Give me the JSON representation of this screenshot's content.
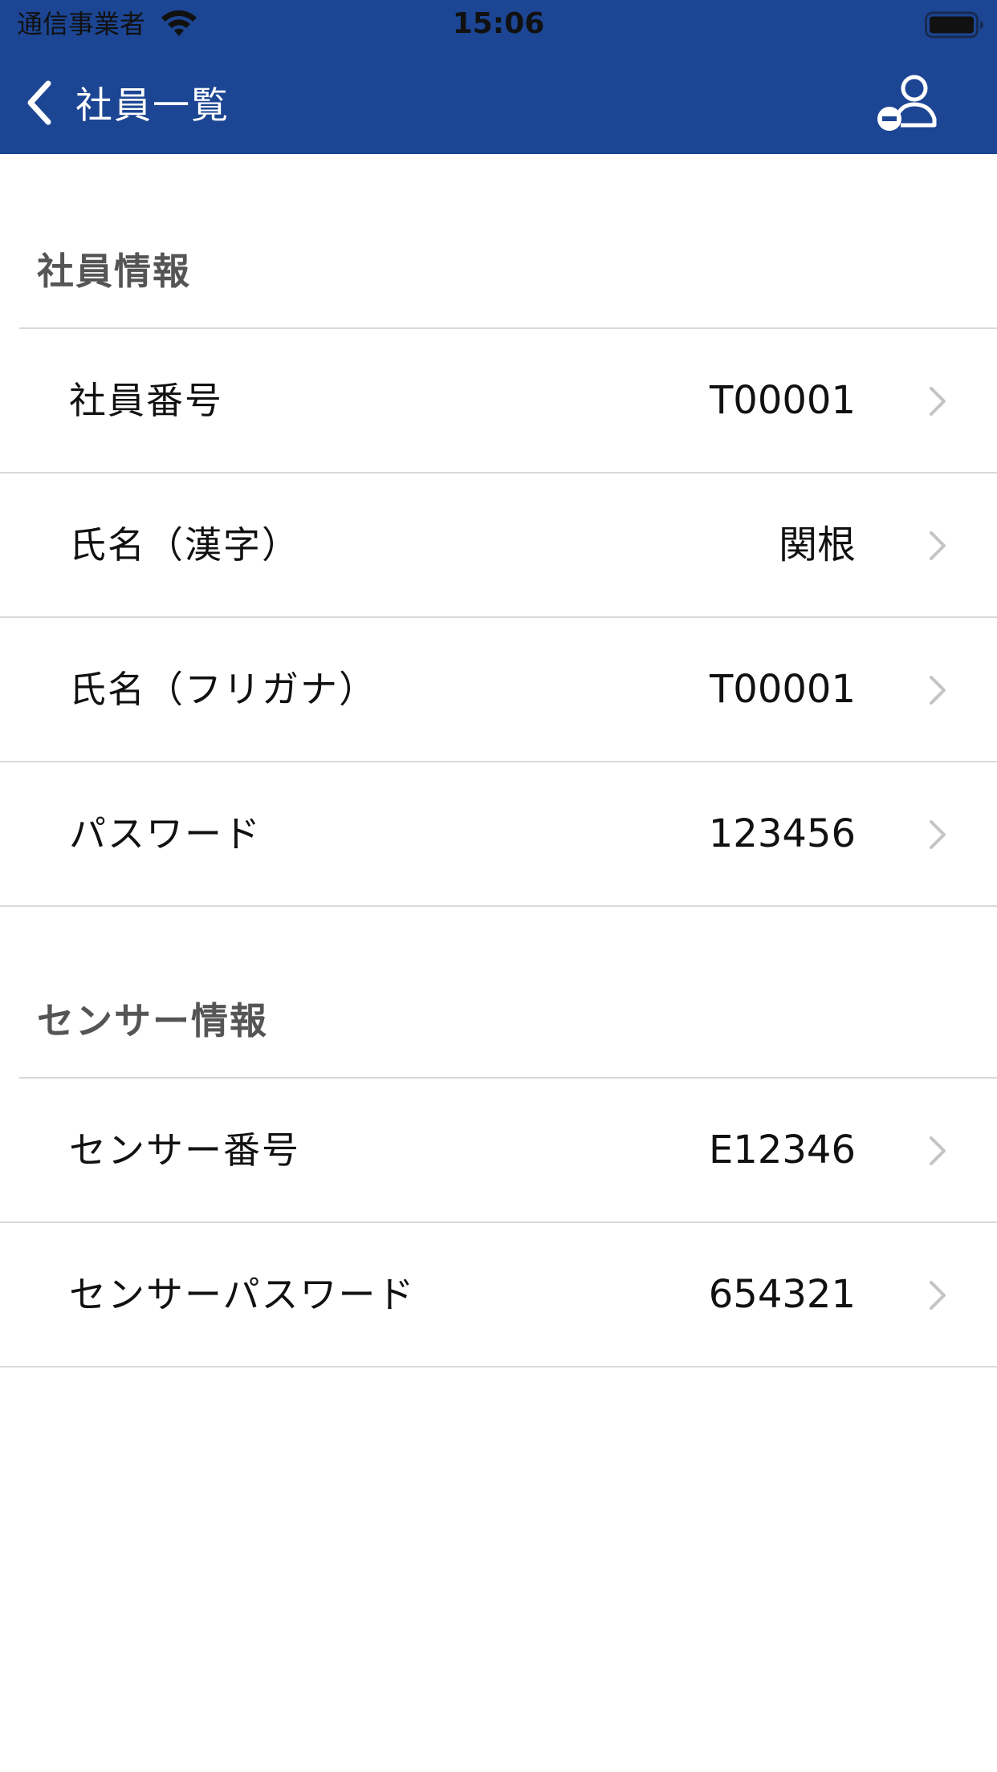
{
  "status_bar": {
    "carrier": "通信事業者",
    "time": "15:06"
  },
  "nav": {
    "back_label": "社員一覧",
    "back_icon": "chevron-left-icon",
    "action_icon": "remove-user-icon"
  },
  "sections": [
    {
      "title": "社員情報",
      "rows": [
        {
          "label": "社員番号",
          "value": "T00001"
        },
        {
          "label": "氏名（漢字）",
          "value": "関根"
        },
        {
          "label": "氏名（フリガナ）",
          "value": "T00001"
        },
        {
          "label": "パスワード",
          "value": "123456"
        }
      ]
    },
    {
      "title": "センサー情報",
      "rows": [
        {
          "label": "センサー番号",
          "value": "E12346"
        },
        {
          "label": "センサーパスワード",
          "value": "654321"
        }
      ]
    }
  ],
  "colors": {
    "nav_background": "#1c4593",
    "section_title": "#555555",
    "divider": "#d9d9d9",
    "chevron": "#c4c4c4"
  }
}
